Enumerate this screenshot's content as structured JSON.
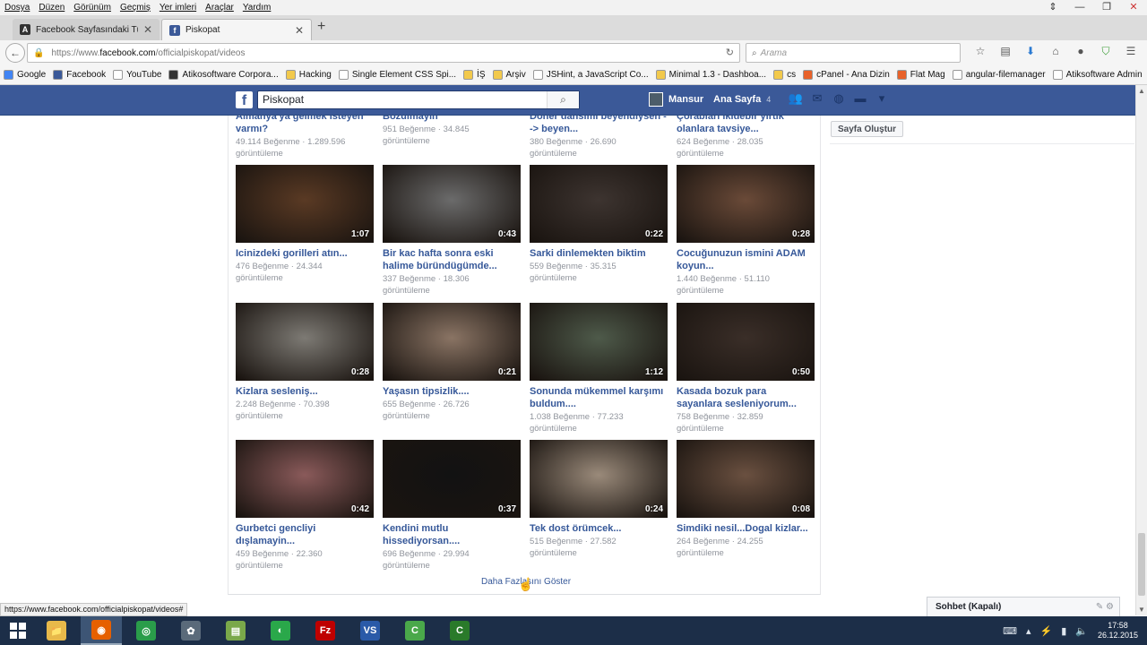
{
  "browser": {
    "menu": [
      "Dosya",
      "Düzen",
      "Görünüm",
      "Geçmiş",
      "Yer imleri",
      "Araçlar",
      "Yardım"
    ],
    "window_controls": [
      "⇕",
      "—",
      "❐",
      "✕"
    ],
    "tabs": [
      {
        "title": "Facebook Sayfasındaki Tü...",
        "icon": "atikosoft-icon"
      },
      {
        "title": "Piskopat",
        "icon": "facebook-icon"
      }
    ],
    "url_prefix": "https://www.",
    "url_domain": "facebook.com",
    "url_path": "/officialpiskopat/videos",
    "search_placeholder": "Arama",
    "bookmarks": [
      {
        "label": "Google",
        "color": "#4285f4"
      },
      {
        "label": "Facebook",
        "color": "#3b5998"
      },
      {
        "label": "YouTube",
        "color": "#ffffff"
      },
      {
        "label": "Atikosoftware Corpora...",
        "color": "#333333"
      },
      {
        "label": "Hacking",
        "color": "#f2c94c"
      },
      {
        "label": "Single Element CSS Spi...",
        "color": "#ffffff"
      },
      {
        "label": "İŞ",
        "color": "#f2c94c"
      },
      {
        "label": "Arşiv",
        "color": "#f2c94c"
      },
      {
        "label": "JSHint, a JavaScript Co...",
        "color": "#ffffff"
      },
      {
        "label": "Minimal 1.3 - Dashboa...",
        "color": "#f2c94c"
      },
      {
        "label": "cs",
        "color": "#f2c94c"
      },
      {
        "label": "cPanel - Ana Dizin",
        "color": "#e8622a"
      },
      {
        "label": "Flat Mag",
        "color": "#e8622a"
      },
      {
        "label": "angular-filemanager",
        "color": "#ffffff"
      },
      {
        "label": "Atiksoftware Admin",
        "color": "#ffffff"
      }
    ],
    "status_url": "https://www.facebook.com/officialpiskopat/videos#"
  },
  "facebook": {
    "search_value": "Piskopat",
    "user_name": "Mansur",
    "home_label": "Ana Sayfa",
    "home_count": "4",
    "create_page_label": "Sayfa Oluştur",
    "show_more_label": "Daha Fazlasını Göster",
    "chat_label": "Sohbet (Kapalı)",
    "partial_row": [
      {
        "title": "Almanya'ya gelmek isteyen varmı?",
        "likes": "49.114 Beğenme",
        "views": "1.289.596",
        "views_suffix": "görüntüleme"
      },
      {
        "title": "Bozulmayın",
        "likes": "951 Beğenme",
        "views": "34.845",
        "views_suffix": "görüntüleme"
      },
      {
        "title": "Döner dansımı beyendiysen --> beyen...",
        "likes": "380 Beğenme",
        "views": "26.690",
        "views_suffix": "görüntüleme"
      },
      {
        "title": "Çorabları ikidebir yırtık olanlara tavsiye...",
        "likes": "624 Beğenme",
        "views": "28.035",
        "views_suffix": "görüntüleme"
      }
    ],
    "videos": [
      {
        "title": "Icinizdeki gorilleri atın...",
        "duration": "1:07",
        "likes": "476 Beğenme",
        "views": "24.344",
        "views_suffix": "görüntüleme",
        "thumb": "#5a3a24"
      },
      {
        "title": "Bir kac hafta sonra eski halime büründügümde...",
        "duration": "0:43",
        "likes": "337 Beğenme",
        "views": "18.306",
        "views_suffix": "görüntüleme",
        "thumb": "#6b6b6b"
      },
      {
        "title": "Sarki dinlemekten biktim",
        "duration": "0:22",
        "likes": "559 Beğenme",
        "views": "35.315",
        "views_suffix": "görüntüleme",
        "thumb": "#3d3430"
      },
      {
        "title": "Cocuğunuzun ismini ADAM koyun...",
        "duration": "0:28",
        "likes": "1.440 Beğenme",
        "views": "51.110",
        "views_suffix": "görüntüleme",
        "thumb": "#6a4a38"
      },
      {
        "title": "Kizlara sesleniş...",
        "duration": "0:28",
        "likes": "2.248 Beğenme",
        "views": "70.398",
        "views_suffix": "görüntüleme",
        "thumb": "#7d7a74"
      },
      {
        "title": "Yaşasın tipsizlik....",
        "duration": "0:21",
        "likes": "655 Beğenme",
        "views": "26.726",
        "views_suffix": "görüntüleme",
        "thumb": "#8a7464"
      },
      {
        "title": "Sonunda mükemmel karşımı buldum....",
        "duration": "1:12",
        "likes": "1.038 Beğenme",
        "views": "77.233",
        "views_suffix": "görüntüleme",
        "thumb": "#4e5a4a"
      },
      {
        "title": "Kasada bozuk para sayanlara sesleniyorum...",
        "duration": "0:50",
        "likes": "758 Beğenme",
        "views": "32.859",
        "views_suffix": "görüntüleme",
        "thumb": "#3a2e28"
      },
      {
        "title": "Gurbetci gencliyi dışlamayin...",
        "duration": "0:42",
        "likes": "459 Beğenme",
        "views": "22.360",
        "views_suffix": "görüntüleme",
        "thumb": "#8a5a5a"
      },
      {
        "title": "Kendini mutlu hissediyorsan....",
        "duration": "0:37",
        "likes": "696 Beğenme",
        "views": "29.994",
        "views_suffix": "görüntüleme",
        "thumb": "#121212"
      },
      {
        "title": "Tek dost örümcek...",
        "duration": "0:24",
        "likes": "515 Beğenme",
        "views": "27.582",
        "views_suffix": "görüntüleme",
        "thumb": "#9a8a7a"
      },
      {
        "title": "Simdiki nesil...Dogal kizlar...",
        "duration": "0:08",
        "likes": "264 Beğenme",
        "views": "24.255",
        "views_suffix": "görüntüleme",
        "thumb": "#6a5040"
      }
    ]
  },
  "taskbar": {
    "apps": [
      {
        "name": "file-explorer",
        "glyph": "📁",
        "color": "#e8b94a"
      },
      {
        "name": "firefox",
        "glyph": "◉",
        "color": "#e66000"
      },
      {
        "name": "chrome",
        "glyph": "◎",
        "color": "#2a9d4a"
      },
      {
        "name": "network-app",
        "glyph": "✿",
        "color": "#5a6a7a"
      },
      {
        "name": "chart-app",
        "glyph": "▤",
        "color": "#7aa84a"
      },
      {
        "name": "globe-app",
        "glyph": "◐",
        "color": "#2aa84a"
      },
      {
        "name": "filezilla",
        "glyph": "Fz",
        "color": "#bf0000"
      },
      {
        "name": "visual-studio",
        "glyph": "VS",
        "color": "#2a5aa8"
      },
      {
        "name": "camtasia-green",
        "glyph": "C",
        "color": "#4aa84a"
      },
      {
        "name": "camtasia-recorder",
        "glyph": "C",
        "color": "#2a7a2a"
      }
    ],
    "time": "17:58",
    "date": "26.12.2015"
  }
}
